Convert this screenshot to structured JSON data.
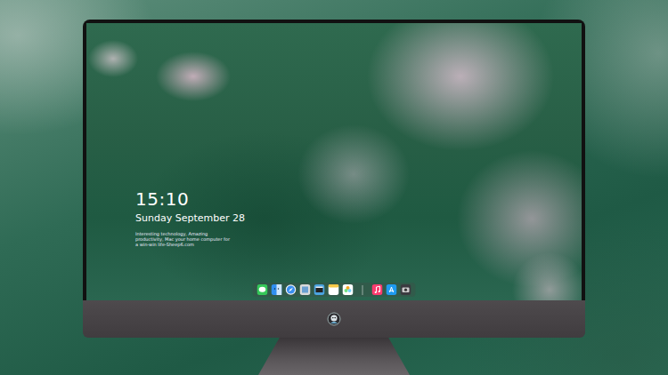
{
  "desktop": {
    "clock": {
      "time": "15:10",
      "date": "Sunday September 28",
      "caption": "Interesting technology, Amazing productivity, Mac your home computer for a win-win life-Sheep6.com"
    },
    "dock": {
      "items": [
        {
          "kind": "messages"
        },
        {
          "kind": "finder"
        },
        {
          "kind": "safari"
        },
        {
          "kind": "preview"
        },
        {
          "kind": "video"
        },
        {
          "kind": "notes"
        },
        {
          "kind": "photos"
        },
        {
          "kind": "separator"
        },
        {
          "kind": "music"
        },
        {
          "kind": "appstore"
        },
        {
          "kind": "camera"
        }
      ]
    }
  }
}
